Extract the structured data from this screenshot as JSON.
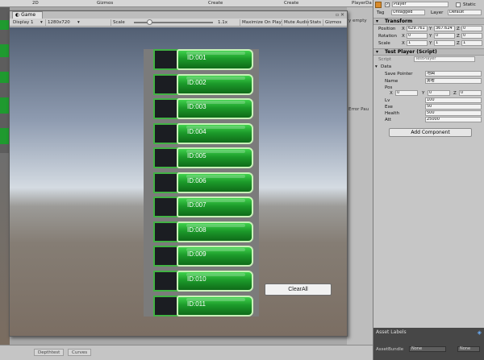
{
  "background": {
    "toolbar_items": [
      "2D",
      "Gizmos",
      "Create",
      "Create",
      "PlayerDa"
    ],
    "bottom_tabs": [
      "Depthtest",
      "Curves"
    ],
    "mid_items": [
      "y empty",
      "Error Pau"
    ]
  },
  "game_window": {
    "tab_title": "Game",
    "display": "Display 1",
    "resolution": "1280x720",
    "scale_label": "Scale",
    "scale_value": "1.1x",
    "maximize_on_play": "Maximize On Play",
    "mute_audio": "Mute Audio",
    "stats": "Stats",
    "gizmos": "Gizmos"
  },
  "list": {
    "items": [
      "ID:001",
      "ID:002",
      "ID:003",
      "ID:004",
      "ID:005",
      "ID:006",
      "ID:007",
      "ID:008",
      "ID:009",
      "ID:010",
      "ID:011"
    ]
  },
  "clear_button": {
    "label": "ClearAll"
  },
  "inspector": {
    "object_name": "Player",
    "static_label": "Static",
    "tag_label": "Tag",
    "tag_value": "Untagged",
    "layer_label": "Layer",
    "layer_value": "Default",
    "transform_header": "Transform",
    "position_label": "Position",
    "position": {
      "x": "629.761",
      "y": "367.624",
      "z": "0"
    },
    "rotation_label": "Rotation",
    "rotation": {
      "x": "0",
      "y": "0",
      "z": "0"
    },
    "scale_label": "Scale",
    "scale": {
      "x": "1",
      "y": "1",
      "z": "1"
    },
    "script_header": "Test Player (Script)",
    "script_label": "Script",
    "script_value": "TestPlayer",
    "data_header": "Data",
    "save_pointer_label": "Save Pointer",
    "save_pointer_value": "地図",
    "name_label": "Name",
    "name_value": "勇者",
    "pos_label": "Pos",
    "pos": {
      "x": "0",
      "y": "0",
      "z": "0"
    },
    "lv_label": "Lv",
    "lv_value": "100",
    "exe_label": "Exe",
    "exe_value": "50",
    "health_label": "Health",
    "health_value": "500",
    "att_label": "Att",
    "att_value": "25000",
    "add_component": "Add Component",
    "asset_labels": "Asset Labels",
    "asset_bundle": "AssetBundle",
    "asset_bundle_value": "None",
    "asset_variant_value": "None"
  }
}
